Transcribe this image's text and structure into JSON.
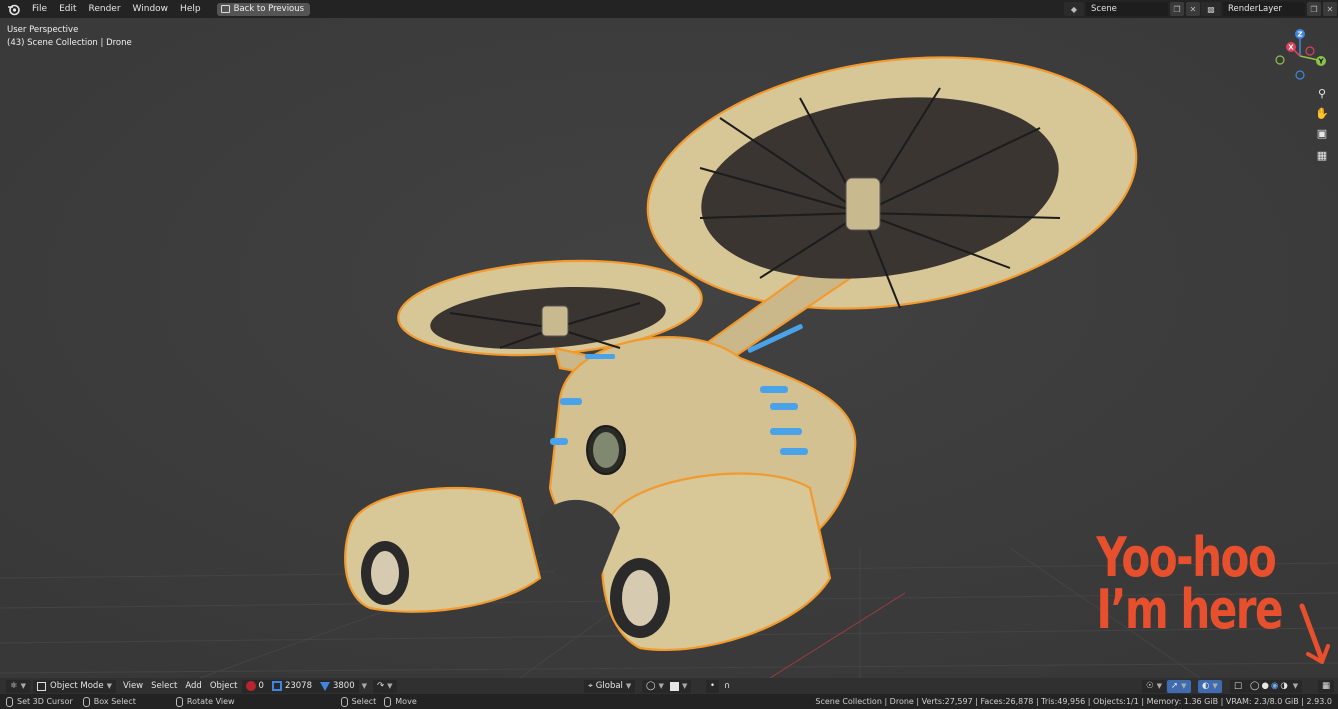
{
  "menubar": {
    "items": [
      "File",
      "Edit",
      "Render",
      "Window",
      "Help"
    ],
    "back_button": "Back to Previous",
    "scene_name": "Scene",
    "layer_name": "RenderLayer"
  },
  "viewport": {
    "view_label": "User Perspective",
    "collection_label": "(43) Scene Collection | Drone",
    "gizmo_axes": {
      "z": "Z",
      "y": "Y",
      "x": "X"
    }
  },
  "annotation": {
    "line1": "Yoo-hoo",
    "line2": "I’m here"
  },
  "toolbar": {
    "mode": "Object Mode",
    "menus": [
      "View",
      "Select",
      "Add",
      "Object"
    ],
    "stat_a": "0",
    "stat_b": "23078",
    "stat_c": "3800",
    "orientation": "Global"
  },
  "statusbar": {
    "set_cursor": "Set 3D Cursor",
    "box_select": "Box Select",
    "rotate_view": "Rotate View",
    "select": "Select",
    "move": "Move",
    "stats": "Scene Collection | Drone | Verts:27,597 | Faces:26,878 | Tris:49,956 | Objects:1/1 | Memory: 1.36 GiB | VRAM: 2.3/8.0 GiB | 2.93.0"
  },
  "colors": {
    "accent_orange": "#e8502d",
    "selection_outline": "#f29a2e",
    "x_axis": "#e0405a",
    "y_axis": "#8bc34a",
    "z_axis": "#3f86e0"
  },
  "icons": [
    "blender-logo",
    "back-icon",
    "scene-icon",
    "layer-icon",
    "zoom-icon",
    "hand-icon",
    "camera-icon",
    "grid-icon",
    "viewport-shading-icons"
  ]
}
